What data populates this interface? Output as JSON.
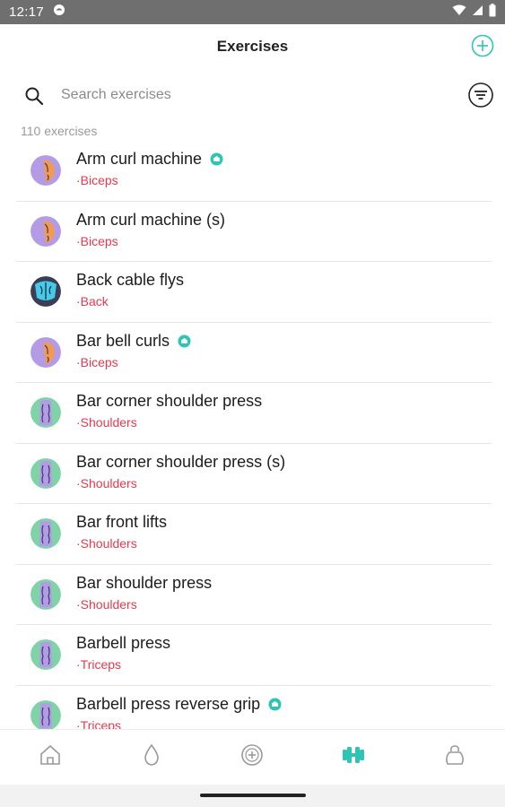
{
  "status_bar": {
    "time": "12:17",
    "icons": [
      "notification-icon",
      "wifi-icon",
      "signal-icon",
      "battery-icon"
    ]
  },
  "header": {
    "title": "Exercises",
    "add_icon": "plus-circle-icon"
  },
  "search": {
    "placeholder": "Search exercises",
    "value": "",
    "search_icon": "search-icon",
    "filter_icon": "filter-icon"
  },
  "count_text": "110 exercises",
  "colors": {
    "accent": "#2ec4b6",
    "muscle_text": "#e53950",
    "divider": "#e6e6e6"
  },
  "exercises": [
    {
      "name": "Arm curl machine",
      "muscle": "·Biceps",
      "badge": true,
      "avatar": "biceps"
    },
    {
      "name": "Arm curl machine (s)",
      "muscle": "·Biceps",
      "badge": false,
      "avatar": "biceps"
    },
    {
      "name": "Back cable flys",
      "muscle": "·Back",
      "badge": false,
      "avatar": "back"
    },
    {
      "name": "Bar bell curls",
      "muscle": "·Biceps",
      "badge": true,
      "avatar": "biceps"
    },
    {
      "name": "Bar corner shoulder press",
      "muscle": "·Shoulders",
      "badge": false,
      "avatar": "shoulders"
    },
    {
      "name": "Bar corner shoulder press (s)",
      "muscle": "·Shoulders",
      "badge": false,
      "avatar": "shoulders"
    },
    {
      "name": "Bar front lifts",
      "muscle": "·Shoulders",
      "badge": false,
      "avatar": "shoulders"
    },
    {
      "name": "Bar shoulder press",
      "muscle": "·Shoulders",
      "badge": false,
      "avatar": "shoulders"
    },
    {
      "name": "Barbell press",
      "muscle": "·Triceps",
      "badge": false,
      "avatar": "shoulders"
    },
    {
      "name": "Barbell press reverse grip",
      "muscle": "·Triceps",
      "badge": true,
      "avatar": "shoulders"
    }
  ],
  "bottom_nav": [
    {
      "icon": "home-icon",
      "active": false
    },
    {
      "icon": "drop-icon",
      "active": false
    },
    {
      "icon": "plus-badge-icon",
      "active": false
    },
    {
      "icon": "dumbbell-icon",
      "active": true
    },
    {
      "icon": "kettlebell-icon",
      "active": false
    }
  ]
}
